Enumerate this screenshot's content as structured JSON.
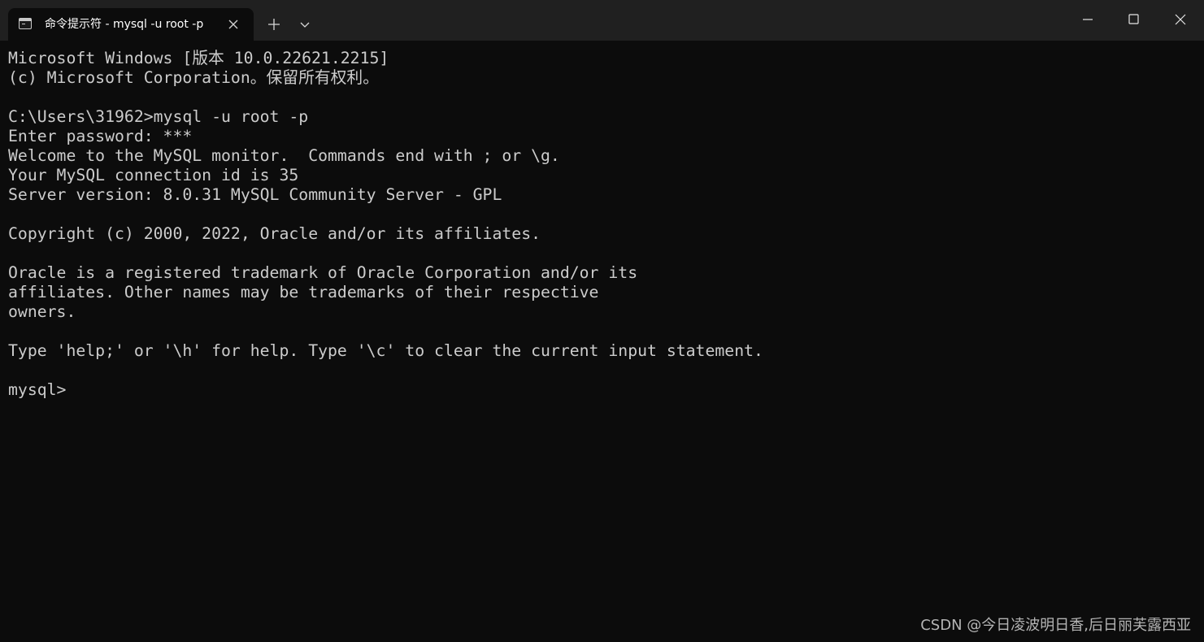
{
  "titlebar": {
    "tab_title": "命令提示符 - mysql  -u root -p",
    "tab_icon": "console-icon",
    "tab_close_icon": "close-icon",
    "new_tab_icon": "plus-icon",
    "dropdown_icon": "chevron-down-icon",
    "window_controls": [
      "minimize-icon",
      "maximize-icon",
      "close-icon"
    ]
  },
  "terminal": {
    "lines": [
      "Microsoft Windows [版本 10.0.22621.2215]",
      "(c) Microsoft Corporation。保留所有权利。",
      "",
      "C:\\Users\\31962>mysql -u root -p",
      "Enter password: ***",
      "Welcome to the MySQL monitor.  Commands end with ; or \\g.",
      "Your MySQL connection id is 35",
      "Server version: 8.0.31 MySQL Community Server - GPL",
      "",
      "Copyright (c) 2000, 2022, Oracle and/or its affiliates.",
      "",
      "Oracle is a registered trademark of Oracle Corporation and/or its",
      "affiliates. Other names may be trademarks of their respective",
      "owners.",
      "",
      "Type 'help;' or '\\h' for help. Type '\\c' to clear the current input statement.",
      "",
      "mysql>"
    ],
    "foreground": "#cccccc",
    "background": "#0c0c0c"
  },
  "watermark": "CSDN @今日凌波明日香,后日丽芙露西亚"
}
